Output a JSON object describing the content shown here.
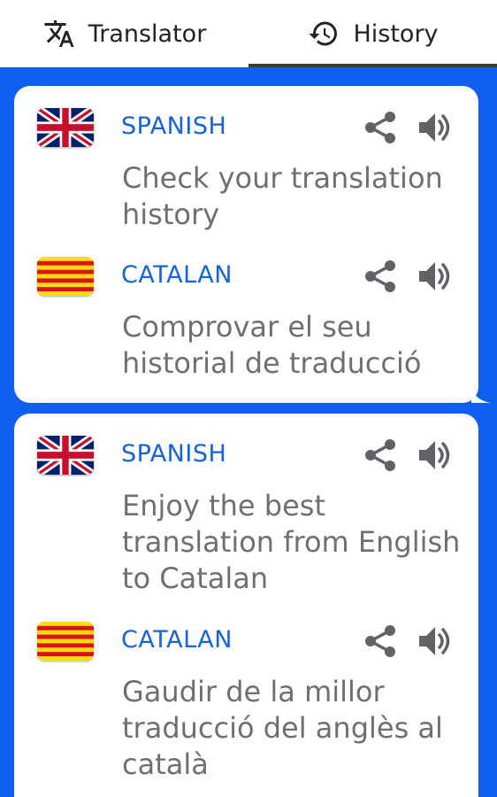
{
  "tabs": [
    {
      "label": "Translator",
      "icon": "translate-icon",
      "active": false
    },
    {
      "label": "History",
      "icon": "history-icon",
      "active": true
    }
  ],
  "colors": {
    "background": "#0f5ef0",
    "language_label": "#1463d9",
    "text": "#6f6f6f",
    "icon": "#5f6368"
  },
  "history": [
    {
      "source": {
        "language": "SPANISH",
        "flag": "uk-flag",
        "text": "Check your translation history"
      },
      "target": {
        "language": "CATALAN",
        "flag": "catalan-flag",
        "text": "Comprovar el seu historial de traducció"
      }
    },
    {
      "source": {
        "language": "SPANISH",
        "flag": "uk-flag",
        "text": "Enjoy the best translation from English to Catalan"
      },
      "target": {
        "language": "CATALAN",
        "flag": "catalan-flag",
        "text": "Gaudir de la millor traducció del anglès al català"
      }
    }
  ]
}
